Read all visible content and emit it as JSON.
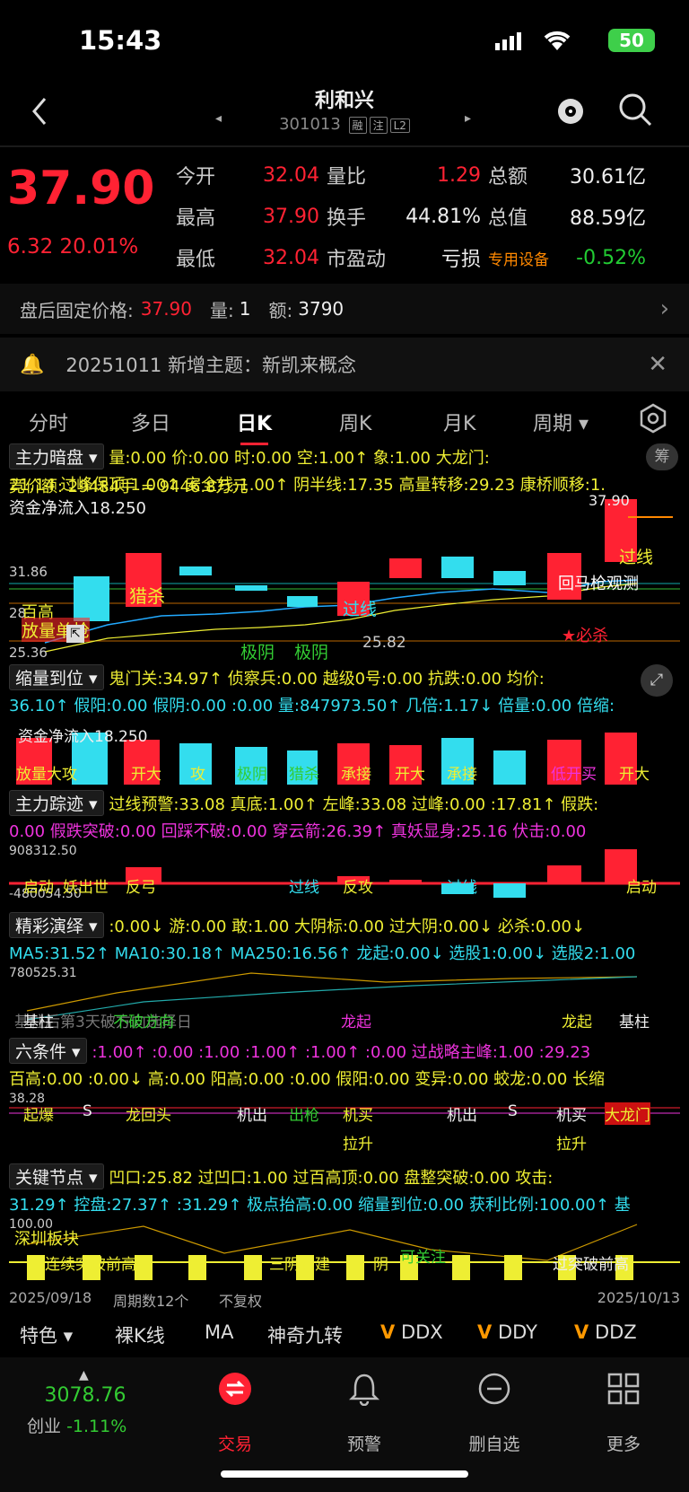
{
  "status": {
    "time": "15:43",
    "battery": "50"
  },
  "stock": {
    "name": "利和兴",
    "code": "301013",
    "tags": [
      "融",
      "注",
      "L2"
    ]
  },
  "quote": {
    "price": "37.90",
    "change": "6.32",
    "change_pct": "20.01%",
    "rows": [
      {
        "l1": "今开",
        "v1": "32.04",
        "l2": "量比",
        "v2": "1.29",
        "l3": "总额",
        "v3": "30.61亿"
      },
      {
        "l1": "最高",
        "v1": "37.90",
        "l2": "换手",
        "v2": "44.81%",
        "l3": "总值",
        "v3": "88.59亿"
      },
      {
        "l1": "最低",
        "v1": "32.04",
        "l2": "市盈动",
        "v2": "亏损",
        "l3": "专用设备",
        "v3": "-0.52%"
      }
    ]
  },
  "after_hours": {
    "label": "盘后固定价格:",
    "price": "37.90",
    "vol_label": "量:",
    "vol": "1",
    "amt_label": "额:",
    "amt": "3790"
  },
  "notice": {
    "text": "20251011 新增主题：新凯来概念"
  },
  "tabs": [
    "分时",
    "多日",
    "日K",
    "周K",
    "月K",
    "周期"
  ],
  "active_tab": "日K",
  "main_indicator": {
    "name": "主力暗盘",
    "line1": "量:0.00 价:0.00 时:0.00 空:1.00↑ 象:1.00 大龙门:",
    "line2": "21.14 过峰保顶:1.00↑ 安全线:1.00↑ 阴半线:17.35 高量转移:29.23 康桥顺移:1.",
    "badge": "筹",
    "overlay1": "竞价额:  29484手 = 9446.8万元",
    "overlay2": "资金净流入18.250",
    "price_high": "37.90",
    "label_3186": "31.86",
    "label_28": "28.",
    "label_2536": "25.36",
    "label_2582": "25.82",
    "tag_liesha": "猎杀",
    "tag_baigao": "百高",
    "tag_fangliang": "放量单枪",
    "tag_guoxian1": "过线",
    "tag_guoxian2": "过线",
    "tag_jiyin1": "极阴",
    "tag_jiyin2": "极阴",
    "tag_huima": "回马枪观测",
    "tag_bisha": "★必杀"
  },
  "panel2": {
    "name": "缩量到位",
    "line1": "鬼门关:34.97↑ 侦察兵:0.00 越级0号:0.00 抗跌:0.00 均价:",
    "line2": "36.10↑ 假阳:0.00 假阴:0.00 :0.00 量:847973.50↑ 几倍:1.17↓ 倍量:0.00 倍缩:",
    "labels": [
      "放量大攻",
      "开大",
      "攻",
      "极阴",
      "猎杀",
      "承接",
      "开大",
      "承接",
      "低开买",
      "开大"
    ]
  },
  "panel3": {
    "name": "主力踪迹",
    "line1": "过线预警:33.08 真底:1.00↑ 左峰:33.08 过峰:0.00 :17.81↑ 假跌:",
    "line2": "0.00 假跌突破:0.00 回踩不破:0.00 穿云箭:26.39↑ 真妖显身:25.16 伏击:0.00",
    "val_top": "908312.50",
    "val_bot": "-480054.50",
    "tags": [
      "启动",
      "妖出世",
      "反弓",
      "过线",
      "反攻",
      "过线",
      "启动"
    ]
  },
  "panel4": {
    "name": "精彩演绎",
    "line1": ":0.00↓ 游:0.00 敢:1.00 大阴标:0.00 过大阴:0.00↓ 必杀:0.00↓",
    "line2": "MA5:31.52↑ MA10:30.18↑ MA250:16.56↑ 龙起:0.00↓ 选股1:0.00↓ 选股2:1.00",
    "val": "780525.31",
    "tags": [
      "基柱",
      "不破方向",
      "龙起",
      "龙起",
      "基柱"
    ],
    "note": "基柱后第3天破方向选择日"
  },
  "panel5": {
    "name": "六条件",
    "line1": ":1.00↑ :0.00 :1.00 :1.00↑ :1.00↑ :0.00 过战略主峰:1.00 :29.23",
    "line2": "百高:0.00 :0.00↓ 高:0.00 阳高:0.00 :0.00 假阳:0.00 变异:0.00 蛟龙:0.00 长缩",
    "val": "38.28",
    "tags": [
      "起爆",
      "S",
      "龙回头",
      "机出",
      "出枪",
      "机买",
      "机出",
      "S",
      "机买",
      "大龙门",
      "拉升",
      "拉升"
    ]
  },
  "panel6": {
    "name": "关键节点",
    "line1": "凹口:25.82 过凹口:1.00 过百高顶:0.00 盘整突破:0.00 攻击:",
    "line2": "31.29↑ 控盘:27.37↑ :31.29↑ 极点抬高:0.00 缩量到位:0.00 获利比例:100.00↑ 基",
    "val": "100.00",
    "tags": [
      "深圳板块",
      "连续突破前高",
      "三阴有建",
      "阴",
      "可关注",
      "过突破前高"
    ]
  },
  "footer_dates": {
    "start": "2025/09/18",
    "period": "周期数12个",
    "fq": "不复权",
    "end": "2025/10/13"
  },
  "tools": [
    "特色",
    "裸K线",
    "MA",
    "神奇九转",
    "DDX",
    "DDY",
    "DDZ"
  ],
  "bottom_nav": {
    "index_value": "3078.76",
    "index_name": "创业",
    "index_change": "-1.11%",
    "items": [
      "交易",
      "预警",
      "删自选",
      "更多"
    ]
  },
  "colors": {
    "up": "#ff2233",
    "down": "#22cc33",
    "cyan": "#33ddee",
    "yellow": "#ffee22",
    "magenta": "#ee33dd"
  }
}
